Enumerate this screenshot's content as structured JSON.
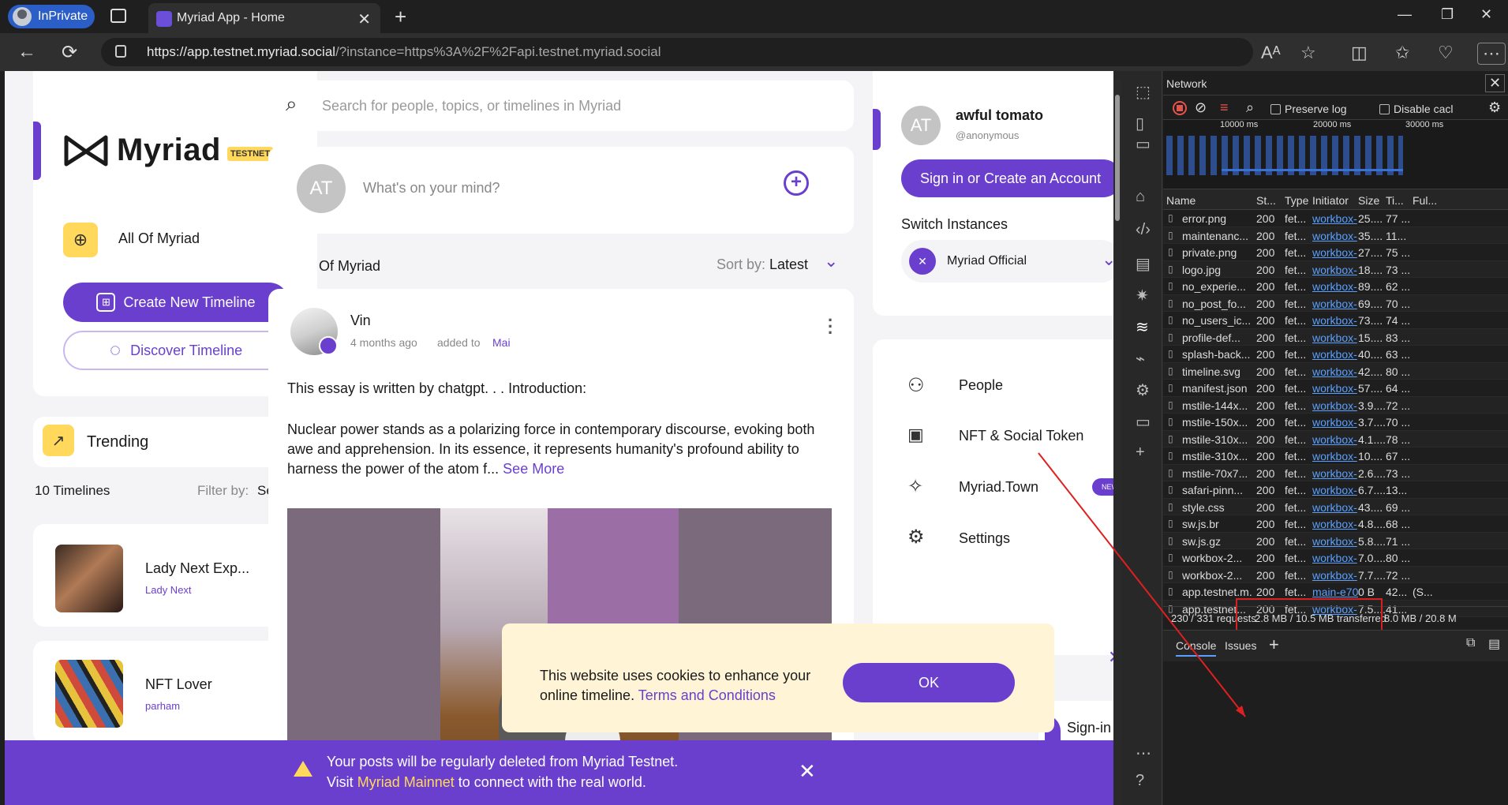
{
  "browser": {
    "inprivate_label": "InPrivate",
    "tab_title": "Myriad App - Home",
    "url_host": "https://app.testnet.myriad.social",
    "url_rest": "/?instance=https%3A%2F%2Fapi.testnet.myriad.social"
  },
  "left": {
    "logo_text": "Myriad",
    "testnet_badge": "TESTNET",
    "all_of_myriad": "All Of Myriad",
    "create_timeline": "Create New Timeline",
    "discover_timeline": "Discover Timeline",
    "trending": "Trending",
    "timelines_count": "10 Timelines",
    "filter_label": "Filter by:",
    "filter_value": "Select",
    "timelines": [
      {
        "title": "Lady Next Exp...",
        "author": "Lady Next"
      },
      {
        "title": "NFT Lover",
        "author": "parham"
      }
    ]
  },
  "center": {
    "search_placeholder": "Search for people, topics, or timelines in Myriad",
    "composer_avatar": "AT",
    "composer_placeholder": "What's on your mind?",
    "feed_title": "Of Myriad",
    "sort_label": "Sort by:",
    "sort_value": "Latest",
    "post": {
      "author": "Vin",
      "time": "4 months ago",
      "added_to": "added to",
      "timeline": "Mai",
      "line1": "This essay is written by chatgpt. . . Introduction:",
      "body": "Nuclear power stands as a polarizing force in contemporary discourse, evoking both awe and apprehension. In its essence, it represents humanity's profound ability to harness the power of the atom f...",
      "see_more": "See More"
    }
  },
  "right": {
    "avatar": "AT",
    "username": "awful tomato",
    "handle": "@anonymous",
    "signin": "Sign in or Create an Account",
    "switch_instances": "Switch Instances",
    "instance": "Myriad Official",
    "menu": [
      "People",
      "NFT & Social Token",
      "Myriad.Town",
      "Settings"
    ],
    "new_badge": "NEW",
    "signin_partial": "Sign-in"
  },
  "cookie": {
    "line1": "This website uses cookies to enhance your",
    "line2": "online timeline.",
    "terms": "Terms and Conditions",
    "ok": "OK"
  },
  "banner": {
    "line1": "Your posts will be regularly deleted from Myriad Testnet.",
    "visit": "Visit",
    "mainnet": "Myriad Mainnet",
    "rest": "to connect with the real world."
  },
  "devtools": {
    "panel": "Network",
    "preserve_log": "Preserve log",
    "disable_cache": "Disable cacl",
    "timeline_ticks": [
      "10000 ms",
      "20000 ms",
      "30000 ms"
    ],
    "columns": [
      "Name",
      "St...",
      "Type",
      "Initiator",
      "Size",
      "Ti...",
      "Ful..."
    ],
    "rows": [
      {
        "name": "error.png",
        "status": "200",
        "type": "fet...",
        "init": "workbox-",
        "size": "25....",
        "time": "77 ..."
      },
      {
        "name": "maintenanc...",
        "status": "200",
        "type": "fet...",
        "init": "workbox-",
        "size": "35....",
        "time": "11..."
      },
      {
        "name": "private.png",
        "status": "200",
        "type": "fet...",
        "init": "workbox-",
        "size": "27....",
        "time": "75 ..."
      },
      {
        "name": "logo.jpg",
        "status": "200",
        "type": "fet...",
        "init": "workbox-",
        "size": "18....",
        "time": "73 ..."
      },
      {
        "name": "no_experie...",
        "status": "200",
        "type": "fet...",
        "init": "workbox-",
        "size": "89....",
        "time": "62 ..."
      },
      {
        "name": "no_post_fo...",
        "status": "200",
        "type": "fet...",
        "init": "workbox-",
        "size": "69....",
        "time": "70 ..."
      },
      {
        "name": "no_users_ic...",
        "status": "200",
        "type": "fet...",
        "init": "workbox-",
        "size": "73....",
        "time": "74 ..."
      },
      {
        "name": "profile-def...",
        "status": "200",
        "type": "fet...",
        "init": "workbox-",
        "size": "15....",
        "time": "83 ..."
      },
      {
        "name": "splash-back...",
        "status": "200",
        "type": "fet...",
        "init": "workbox-",
        "size": "40....",
        "time": "63 ..."
      },
      {
        "name": "timeline.svg",
        "status": "200",
        "type": "fet...",
        "init": "workbox-",
        "size": "42....",
        "time": "80 ..."
      },
      {
        "name": "manifest.json",
        "status": "200",
        "type": "fet...",
        "init": "workbox-",
        "size": "57....",
        "time": "64 ..."
      },
      {
        "name": "mstile-144x...",
        "status": "200",
        "type": "fet...",
        "init": "workbox-",
        "size": "3.9....",
        "time": "72 ..."
      },
      {
        "name": "mstile-150x...",
        "status": "200",
        "type": "fet...",
        "init": "workbox-",
        "size": "3.7....",
        "time": "70 ..."
      },
      {
        "name": "mstile-310x...",
        "status": "200",
        "type": "fet...",
        "init": "workbox-",
        "size": "4.1....",
        "time": "78 ..."
      },
      {
        "name": "mstile-310x...",
        "status": "200",
        "type": "fet...",
        "init": "workbox-",
        "size": "10....",
        "time": "67 ..."
      },
      {
        "name": "mstile-70x7...",
        "status": "200",
        "type": "fet...",
        "init": "workbox-",
        "size": "2.6....",
        "time": "73 ..."
      },
      {
        "name": "safari-pinn...",
        "status": "200",
        "type": "fet...",
        "init": "workbox-",
        "size": "6.7....",
        "time": "13..."
      },
      {
        "name": "style.css",
        "status": "200",
        "type": "fet...",
        "init": "workbox-",
        "size": "43....",
        "time": "69 ..."
      },
      {
        "name": "sw.js.br",
        "status": "200",
        "type": "fet...",
        "init": "workbox-",
        "size": "4.8....",
        "time": "68 ..."
      },
      {
        "name": "sw.js.gz",
        "status": "200",
        "type": "fet...",
        "init": "workbox-",
        "size": "5.8....",
        "time": "71 ..."
      },
      {
        "name": "workbox-2...",
        "status": "200",
        "type": "fet...",
        "init": "workbox-",
        "size": "7.0....",
        "time": "80 ..."
      },
      {
        "name": "workbox-2...",
        "status": "200",
        "type": "fet...",
        "init": "workbox-",
        "size": "7.7....",
        "time": "72 ..."
      },
      {
        "name": "app.testnet.m...",
        "status": "200",
        "type": "fet...",
        "init": "main-e70",
        "size": "0 B",
        "time": "42...",
        "full": "(S..."
      },
      {
        "name": "app.testnet...",
        "status": "200",
        "type": "fet...",
        "init": "workbox-",
        "size": "7.5....",
        "time": "41..."
      }
    ],
    "summary_requests": "230 / 331 requests",
    "summary_transferred": "2.8 MB / 10.5 MB transferred",
    "summary_resources": "8.0 MB / 20.8 M",
    "drawer_tabs": [
      "Console",
      "Issues"
    ]
  }
}
